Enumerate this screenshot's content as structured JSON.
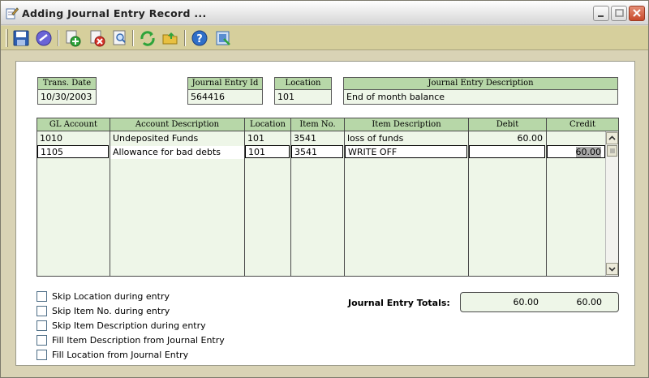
{
  "window": {
    "title": "Adding Journal Entry Record ..."
  },
  "toolbar": {
    "buttons": [
      "save-icon",
      "next-icon",
      "add-icon",
      "delete-icon",
      "find-icon",
      "refresh-icon",
      "open-icon",
      "help-icon",
      "exit-icon"
    ]
  },
  "header": {
    "trans_date_label": "Trans. Date",
    "trans_date": "10/30/2003",
    "journal_id_label": "Journal Entry Id",
    "journal_id": "564416",
    "location_label": "Location",
    "location": "101",
    "description_label": "Journal Entry Description",
    "description": "End of month balance"
  },
  "grid": {
    "columns": [
      "GL Account",
      "Account Description",
      "Location",
      "Item No.",
      "Item Description",
      "Debit",
      "Credit"
    ],
    "rows": [
      {
        "gl": "1010",
        "desc": "Undeposited Funds",
        "loc": "101",
        "item": "3541",
        "item_desc": "loss of funds",
        "debit": "60.00",
        "credit": ""
      },
      {
        "gl": "1105",
        "desc": "Allowance for bad debts",
        "loc": "101",
        "item": "3541",
        "item_desc": "WRITE OFF",
        "debit": "",
        "credit": "60.00"
      }
    ]
  },
  "options": [
    "Skip Location during entry",
    "Skip Item No. during entry",
    "Skip Item Description during entry",
    "Fill Item Description from Journal Entry",
    "Fill Location from Journal Entry"
  ],
  "totals": {
    "label": "Journal Entry Totals:",
    "debit": "60.00",
    "credit": "60.00"
  }
}
